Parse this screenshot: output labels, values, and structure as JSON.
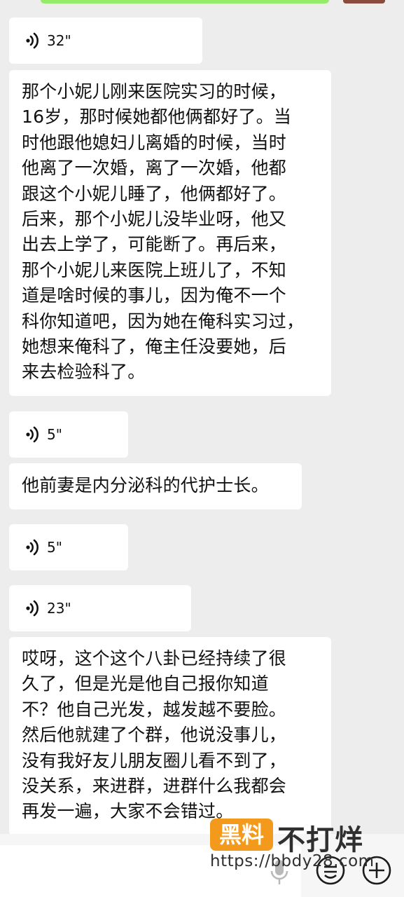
{
  "messages": [
    {
      "type": "voice",
      "duration": "32\""
    },
    {
      "type": "text",
      "lines": [
        "那个小妮儿刚来医院实习的时候，",
        "16岁，那时候她都他俩都好了。当",
        "时他跟他媳妇儿离婚的时候，当时",
        "他离了一次婚，离了一次婚，他都",
        "跟这个小妮儿睡了，他俩都好了。",
        "后来，那个小妮儿没毕业呀，他又",
        "出去上学了，可能断了。再后来，",
        "那个小妮儿来医院上班儿了，不知",
        "道是啥时候的事儿，因为俺不一个",
        "科你知道吧，因为她在俺科实习过，",
        "她想来俺科了，俺主任没要她，后",
        "来去检验科了。"
      ]
    },
    {
      "type": "voice",
      "duration": "5\""
    },
    {
      "type": "text",
      "lines": [
        "他前妻是内分泌科的代护士长。"
      ]
    },
    {
      "type": "voice",
      "duration": "5\""
    },
    {
      "type": "voice",
      "duration": "23\""
    },
    {
      "type": "text",
      "lines": [
        "哎呀，这个这个八卦已经持续了很",
        "久了，但是光是他自己报你知道",
        "不？他自己光发，越发越不要脸。",
        "然后他就建了个群，他说没事儿，",
        "没有我好友儿朋友圈儿看不到了，",
        "没关系，来进群，进群什么我都会",
        "再发一遍，大家不会错过。"
      ]
    }
  ],
  "watermark": {
    "badge": "黑料",
    "title": "不打烊",
    "url": "https://bbdy28.com"
  },
  "icons": {
    "voice": "voice-wave-icon",
    "mic": "microphone-icon",
    "emoji": "emoji-icon",
    "plus": "plus-icon"
  },
  "colors": {
    "background": "#ededed",
    "bubble": "#ffffff",
    "sent_bubble": "#95ec69",
    "watermark_badge": "#f39a1c"
  }
}
